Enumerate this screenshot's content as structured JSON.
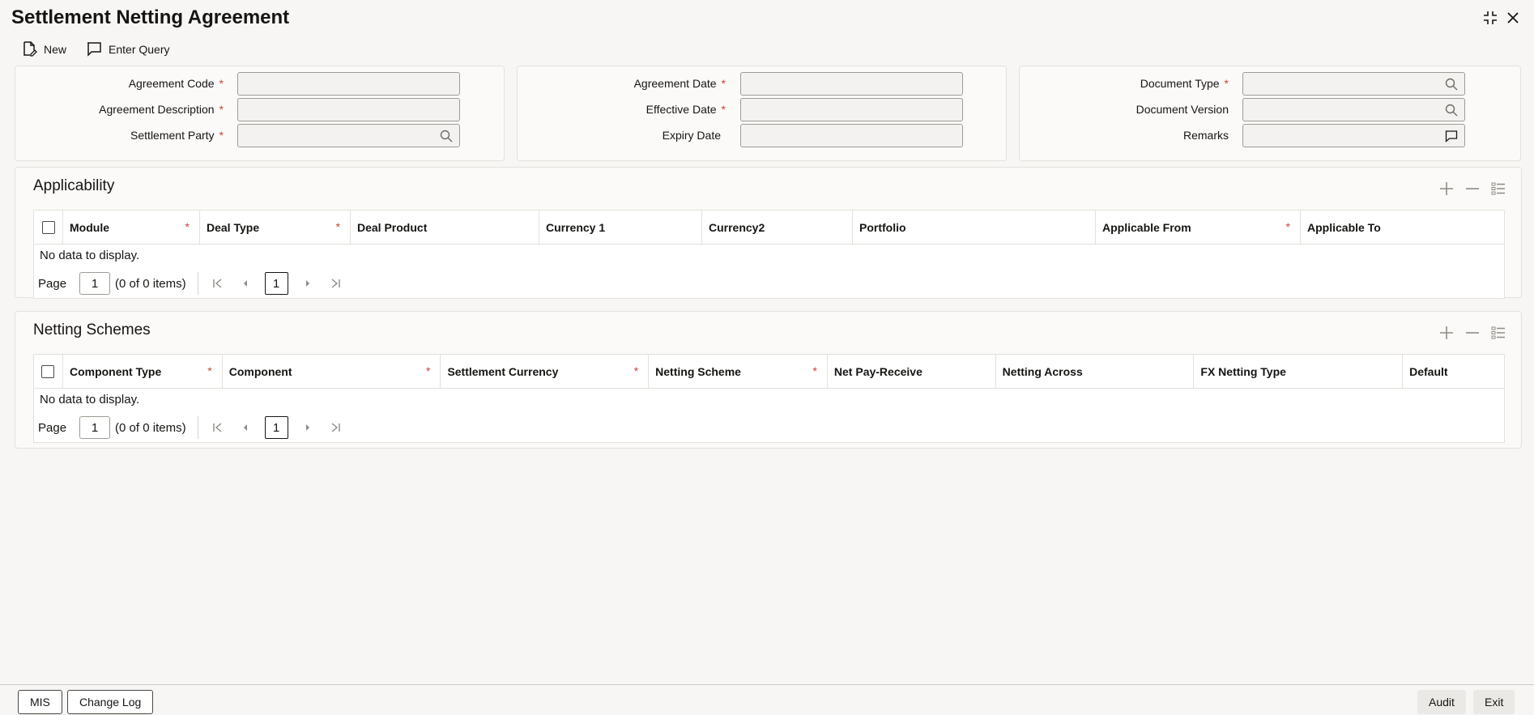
{
  "header": {
    "title": "Settlement Netting Agreement"
  },
  "toolbar": {
    "new_label": "New",
    "enter_query_label": "Enter Query"
  },
  "form": {
    "agreement_code": {
      "label": "Agreement Code",
      "required": "*",
      "value": ""
    },
    "agreement_description": {
      "label": "Agreement Description",
      "required": "*",
      "value": ""
    },
    "settlement_party": {
      "label": "Settlement Party",
      "required": "*",
      "value": ""
    },
    "agreement_date": {
      "label": "Agreement Date",
      "required": "*",
      "value": ""
    },
    "effective_date": {
      "label": "Effective Date",
      "required": "*",
      "value": ""
    },
    "expiry_date": {
      "label": "Expiry Date",
      "value": ""
    },
    "document_type": {
      "label": "Document Type",
      "required": "*",
      "value": ""
    },
    "document_version": {
      "label": "Document Version",
      "value": ""
    },
    "remarks": {
      "label": "Remarks",
      "value": ""
    }
  },
  "applicability": {
    "title": "Applicability",
    "columns": [
      {
        "label": "Module",
        "required": "*"
      },
      {
        "label": "Deal Type",
        "required": "*"
      },
      {
        "label": "Deal Product",
        "required": ""
      },
      {
        "label": "Currency 1",
        "required": ""
      },
      {
        "label": "Currency2",
        "required": ""
      },
      {
        "label": "Portfolio",
        "required": ""
      },
      {
        "label": "Applicable From",
        "required": "*"
      },
      {
        "label": "Applicable To",
        "required": ""
      }
    ],
    "empty_text": "No data to display.",
    "pager": {
      "page_label": "Page",
      "page_value": "1",
      "count_text": "(0 of 0 items)",
      "current_page": "1"
    }
  },
  "netting_schemes": {
    "title": "Netting Schemes",
    "columns": [
      {
        "label": "Component Type",
        "required": "*"
      },
      {
        "label": "Component",
        "required": "*"
      },
      {
        "label": "Settlement Currency",
        "required": "*"
      },
      {
        "label": "Netting Scheme",
        "required": "*"
      },
      {
        "label": "Net Pay-Receive",
        "required": ""
      },
      {
        "label": "Netting Across",
        "required": ""
      },
      {
        "label": "FX Netting Type",
        "required": ""
      },
      {
        "label": "Default",
        "required": ""
      }
    ],
    "empty_text": "No data to display.",
    "pager": {
      "page_label": "Page",
      "page_value": "1",
      "count_text": "(0 of 0 items)",
      "current_page": "1"
    }
  },
  "footer": {
    "mis_label": "MIS",
    "change_log_label": "Change Log",
    "audit_label": "Audit",
    "exit_label": "Exit"
  },
  "colors": {
    "required_star": "#c74634",
    "page_bg": "#f7f6f4",
    "text": "#161513"
  }
}
